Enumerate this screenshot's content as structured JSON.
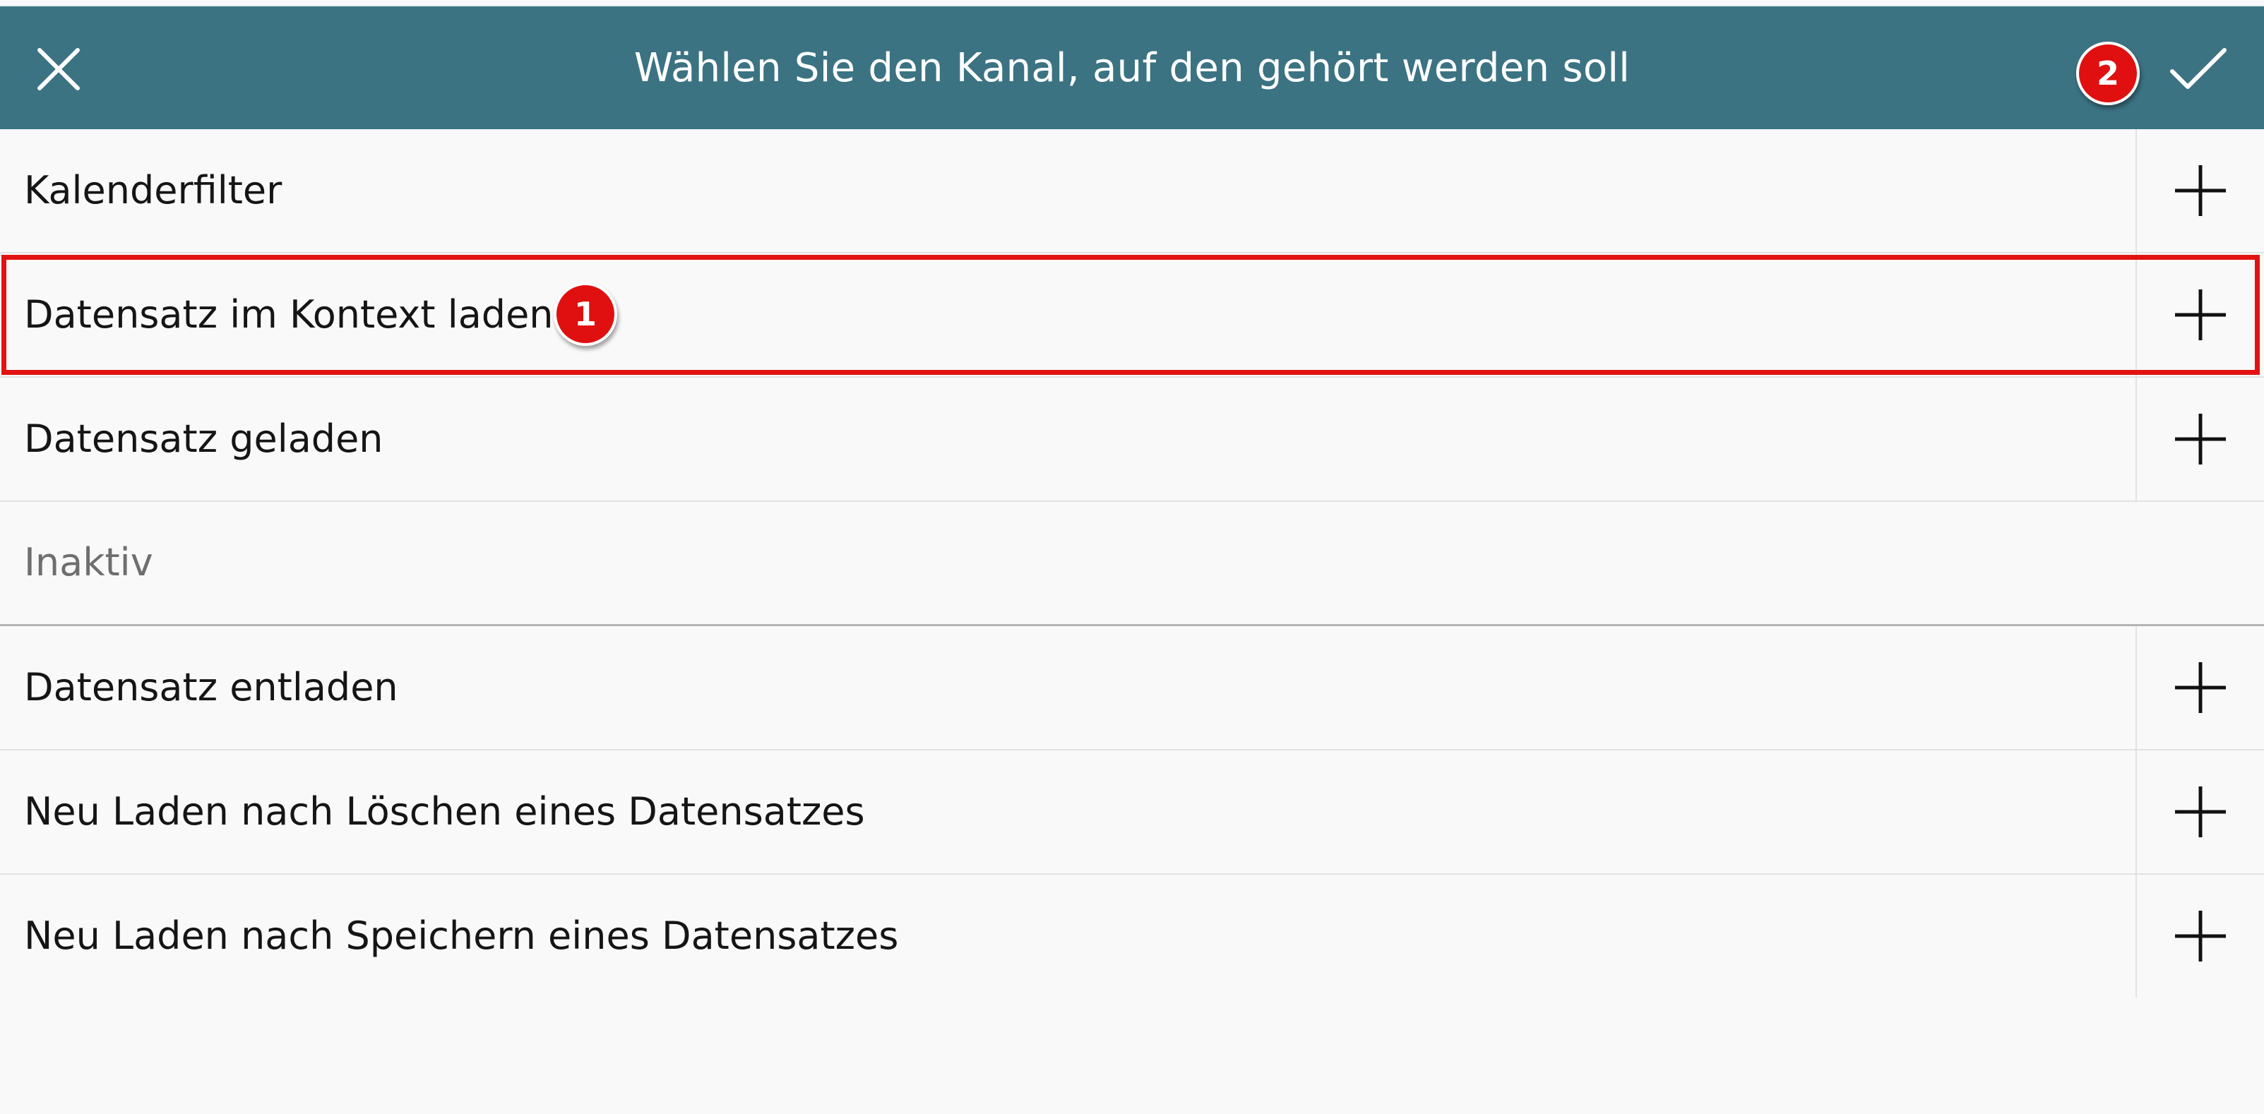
{
  "dialog": {
    "title": "Wählen Sie den Kanal, auf den gehört werden soll",
    "header_color": "#3b7383"
  },
  "annotations": {
    "marker_1": "1",
    "marker_2": "2",
    "marker_color": "#e01010",
    "highlight_color": "#e21212"
  },
  "channels": [
    {
      "label": "Kalenderfilter",
      "action_icon": "plus-icon"
    },
    {
      "label": "Datensatz im Kontext laden",
      "action_icon": "plus-icon"
    },
    {
      "label": "Datensatz geladen",
      "action_icon": "plus-icon"
    }
  ],
  "inactive_section": {
    "label": "Inaktiv",
    "channels": [
      {
        "label": "Datensatz entladen",
        "action_icon": "plus-icon"
      },
      {
        "label": "Neu Laden nach Löschen eines Datensatzes",
        "action_icon": "plus-icon"
      },
      {
        "label": "Neu Laden nach Speichern eines Datensatzes",
        "action_icon": "plus-icon"
      }
    ]
  }
}
